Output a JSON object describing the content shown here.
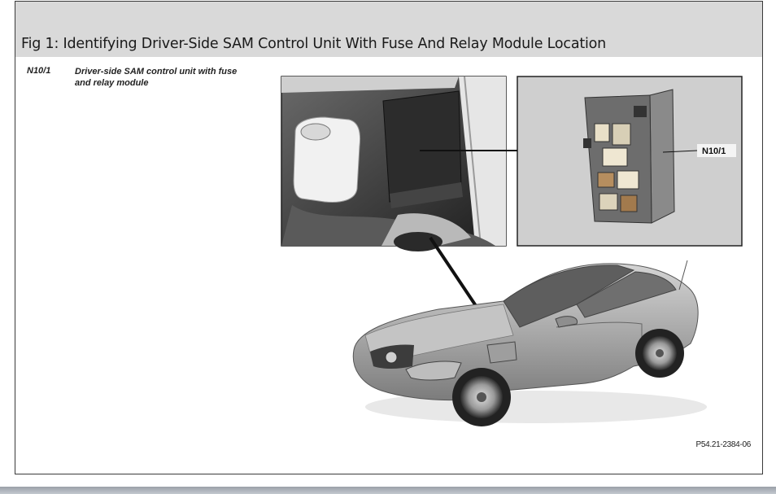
{
  "figure": {
    "title": "Fig 1: Identifying Driver-Side SAM Control Unit With Fuse And Relay Module Location",
    "legend": {
      "code": "N10/1",
      "description": "Driver-side SAM control unit with fuse and relay module"
    },
    "callout_label": "N10/1",
    "reference_code": "P54.21-2384-06"
  }
}
